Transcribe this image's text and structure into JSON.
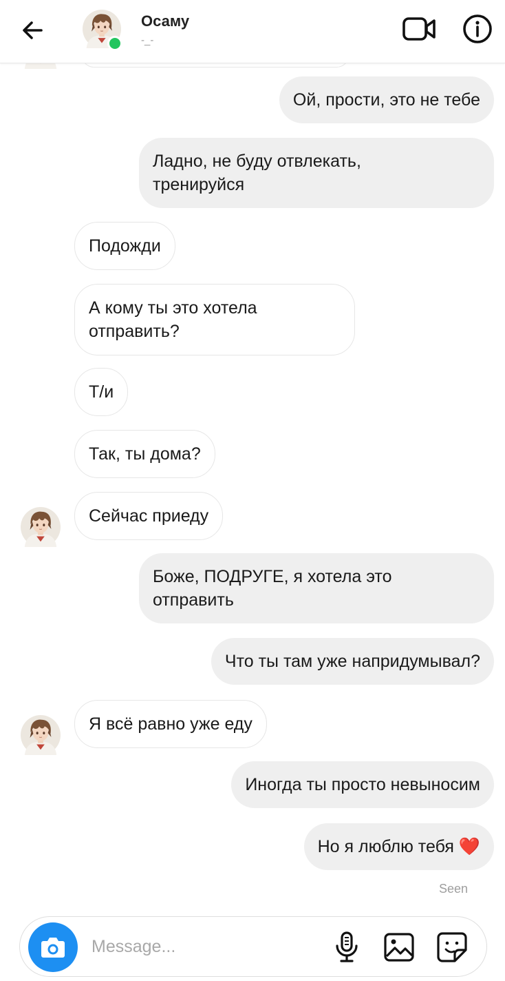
{
  "header": {
    "name": "Осаму",
    "status": "-_-",
    "icons": {
      "back": "arrow-left-icon",
      "video": "video-camera-icon",
      "info": "info-icon"
    }
  },
  "messages": [
    {
      "from": "me",
      "text": "Ой, прости, это не тебе"
    },
    {
      "from": "me",
      "text": "Ладно, не буду отвлекать,\nтренируйся"
    },
    {
      "from": "them",
      "text": "Подожди"
    },
    {
      "from": "them",
      "text": "А кому ты это хотела\nотправить?"
    },
    {
      "from": "them",
      "text": "Т/и"
    },
    {
      "from": "them",
      "text": "Так, ты дома?"
    },
    {
      "from": "them",
      "text": "Сейчас приеду"
    },
    {
      "from": "me",
      "text": "Боже, ПОДРУГЕ, я хотела это\nотправить"
    },
    {
      "from": "me",
      "text": "Что ты там уже напридумывал?"
    },
    {
      "from": "them",
      "text": "Я всё равно уже еду"
    },
    {
      "from": "me",
      "text": "Иногда ты просто невыносим"
    },
    {
      "from": "me",
      "text": "Но я люблю тебя",
      "emoji": "❤️"
    }
  ],
  "seen_label": "Seen",
  "composer": {
    "placeholder": "Message...",
    "icons": [
      "camera-icon",
      "microphone-icon",
      "gallery-icon",
      "sticker-icon"
    ]
  },
  "colors": {
    "outgoing_bubble": "#efefef",
    "incoming_border": "#e6e6e6",
    "online": "#22c55e",
    "camera_button": "#1d8ff2",
    "heart": "#e53935"
  }
}
